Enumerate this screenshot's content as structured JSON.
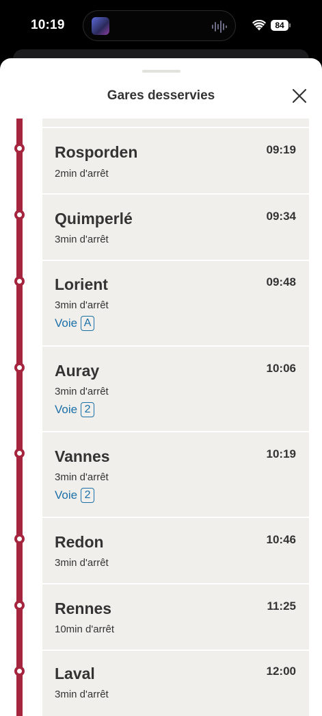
{
  "status_bar": {
    "time": "10:19",
    "battery": "84"
  },
  "header": {
    "title": "Gares desservies"
  },
  "colors": {
    "route_line": "#a5253f",
    "voie_link": "#1a6fa8",
    "card_bg": "#f0efeb",
    "text": "#333333"
  },
  "stops": [
    {
      "name": "Rosporden",
      "time": "09:19",
      "dwell": "2min d'arrêt"
    },
    {
      "name": "Quimperlé",
      "time": "09:34",
      "dwell": "3min d'arrêt"
    },
    {
      "name": "Lorient",
      "time": "09:48",
      "dwell": "3min d'arrêt",
      "voie_label": "Voie",
      "voie": "A"
    },
    {
      "name": "Auray",
      "time": "10:06",
      "dwell": "3min d'arrêt",
      "voie_label": "Voie",
      "voie": "2"
    },
    {
      "name": "Vannes",
      "time": "10:19",
      "dwell": "3min d'arrêt",
      "voie_label": "Voie",
      "voie": "2"
    },
    {
      "name": "Redon",
      "time": "10:46",
      "dwell": "3min d'arrêt"
    },
    {
      "name": "Rennes",
      "time": "11:25",
      "dwell": "10min d'arrêt"
    },
    {
      "name": "Laval",
      "time": "12:00",
      "dwell": "3min d'arrêt"
    }
  ]
}
